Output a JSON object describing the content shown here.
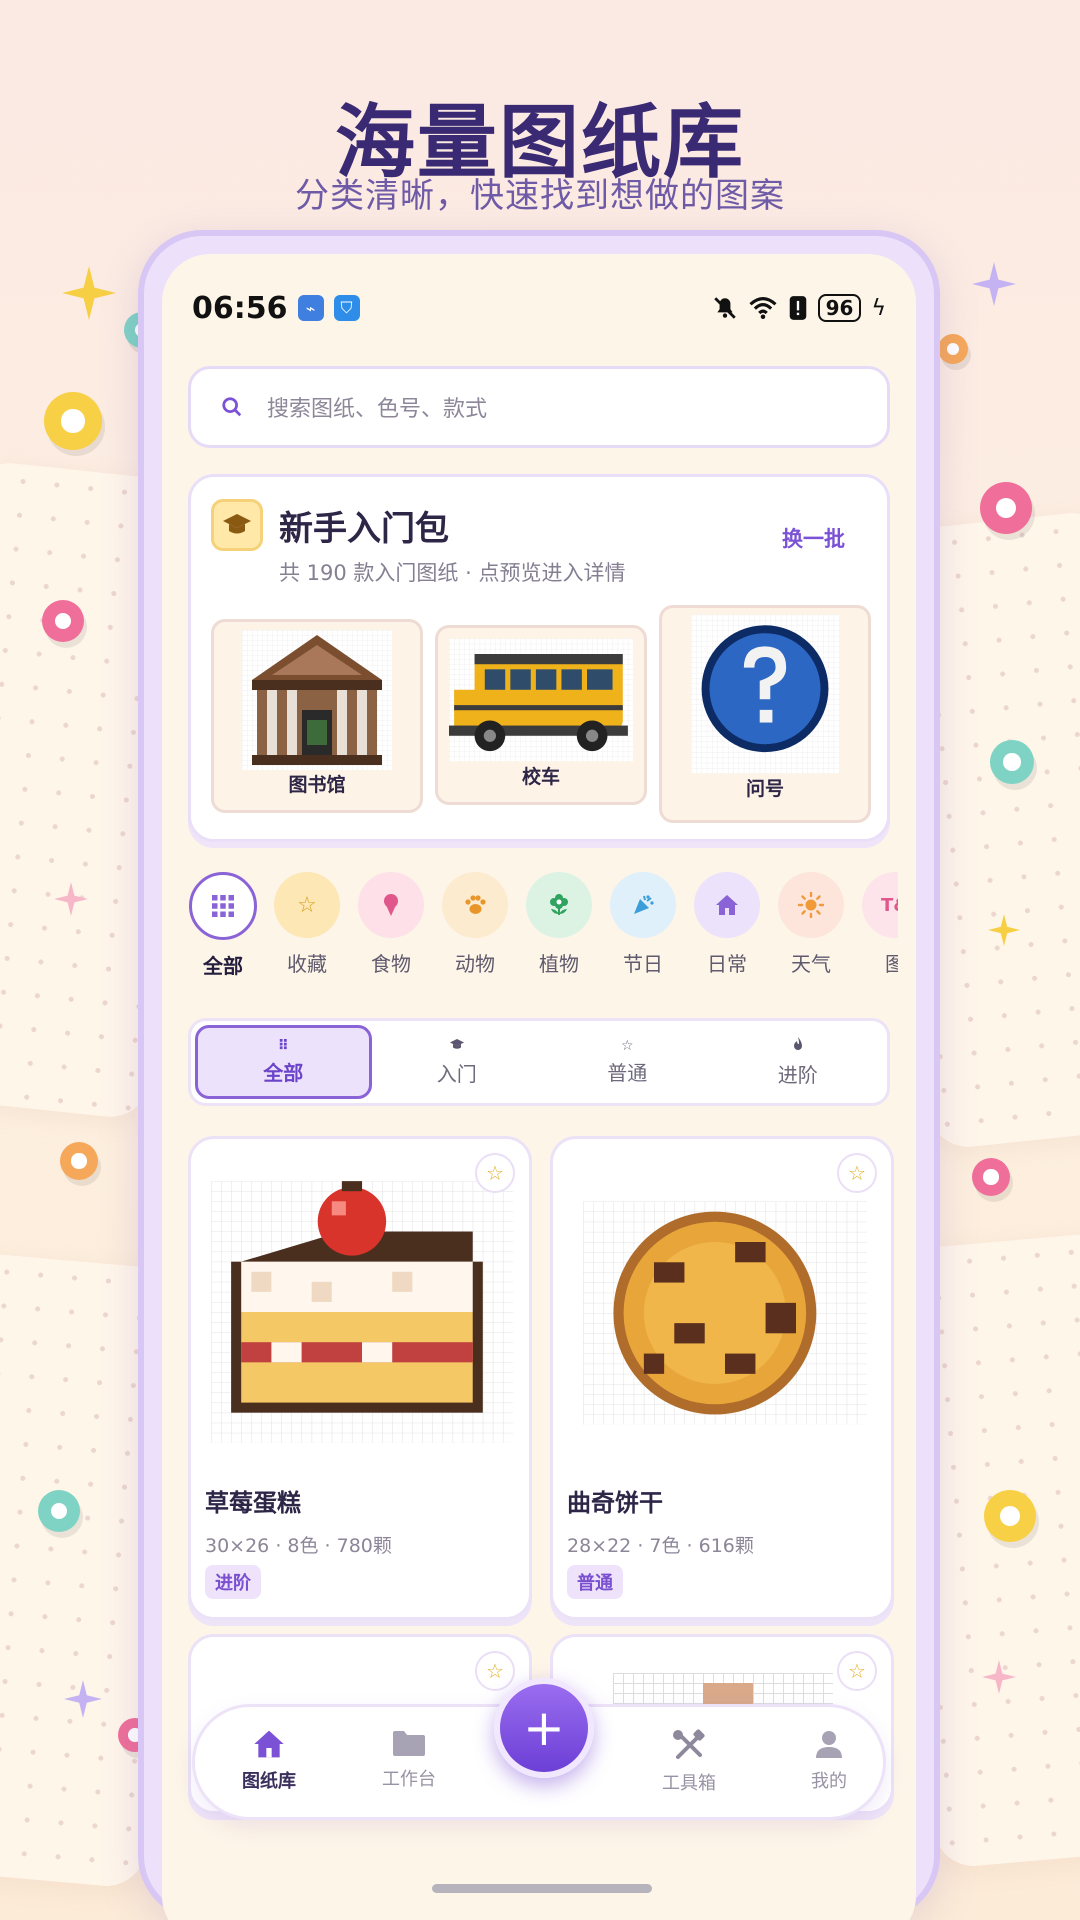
{
  "promo": {
    "headline": "海量图纸库",
    "subheadline": "分类清晰，快速找到想做的图案"
  },
  "status_bar": {
    "time": "06:56",
    "battery": "96"
  },
  "search": {
    "placeholder": "搜索图纸、色号、款式"
  },
  "starter_pack": {
    "title": "新手入门包",
    "subtitle": "共 190 款入门图纸 · 点预览进入详情",
    "refresh_label": "换一批",
    "samples": [
      {
        "label": "图书馆",
        "icon": "library-pixel-art"
      },
      {
        "label": "校车",
        "icon": "school-bus-pixel-art"
      },
      {
        "label": "问号",
        "icon": "question-mark-pixel-art"
      }
    ]
  },
  "categories": [
    {
      "label": "全部",
      "icon": "grid-icon",
      "color": "#8a63d6",
      "active": true
    },
    {
      "label": "收藏",
      "icon": "star-icon",
      "color": "#fde7b5"
    },
    {
      "label": "食物",
      "icon": "ice-cream-icon",
      "color": "#fde0e8"
    },
    {
      "label": "动物",
      "icon": "paw-icon",
      "color": "#fdebcf"
    },
    {
      "label": "植物",
      "icon": "flower-icon",
      "color": "#dcf3e4"
    },
    {
      "label": "节日",
      "icon": "party-popper-icon",
      "color": "#dff0fb"
    },
    {
      "label": "日常",
      "icon": "home-icon",
      "color": "#ece2fb"
    },
    {
      "label": "天气",
      "icon": "sun-icon",
      "color": "#fde5dc"
    },
    {
      "label": "图",
      "icon": "text-icon",
      "color": "#fde4ea"
    }
  ],
  "difficulty_tabs": [
    {
      "label": "全部",
      "icon": "grid-icon",
      "active": true
    },
    {
      "label": "入门",
      "icon": "graduation-cap-icon"
    },
    {
      "label": "普通",
      "icon": "star-icon"
    },
    {
      "label": "进阶",
      "icon": "flame-icon"
    }
  ],
  "patterns": [
    {
      "title": "草莓蛋糕",
      "meta": "30×26 · 8色 · 780颗",
      "level": "进阶"
    },
    {
      "title": "曲奇饼干",
      "meta": "28×22 · 7色 · 616颗",
      "level": "普通"
    }
  ],
  "bottom_nav": {
    "items": [
      {
        "label": "图纸库",
        "icon": "home-icon",
        "active": true
      },
      {
        "label": "工作台",
        "icon": "folder-icon"
      },
      {
        "label": "工具箱",
        "icon": "tools-icon"
      },
      {
        "label": "我的",
        "icon": "user-icon"
      }
    ],
    "fab_label": "+"
  },
  "colors": {
    "accent": "#7b52d6",
    "headline": "#3a2a73",
    "background": "#fdf5e8"
  }
}
